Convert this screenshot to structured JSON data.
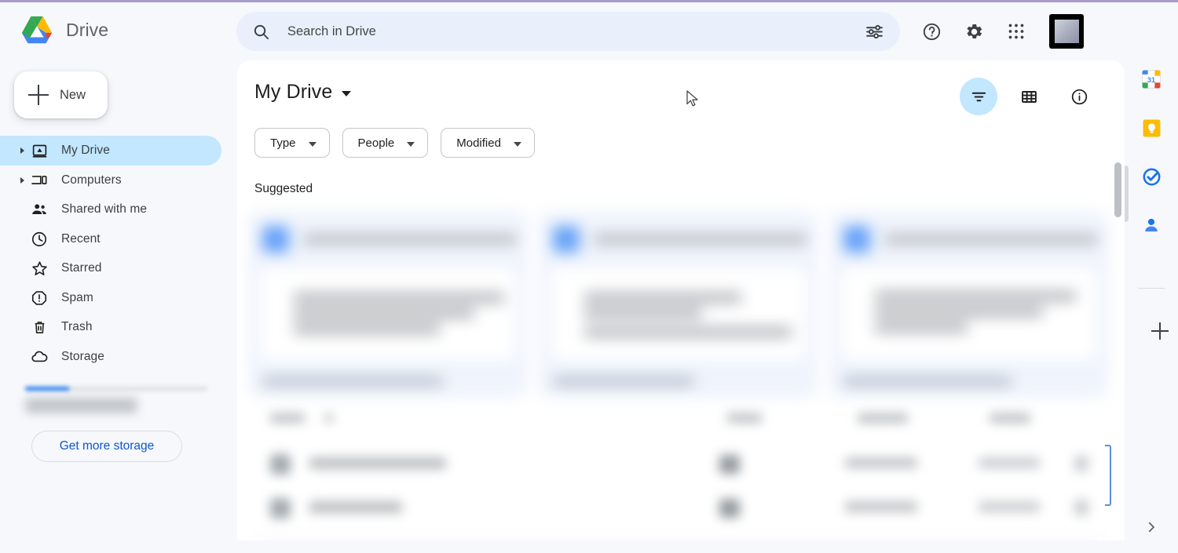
{
  "app": {
    "brand_name": "Drive",
    "logo": "drive-logo"
  },
  "search": {
    "placeholder": "Search in Drive",
    "value": "",
    "icon": "search-icon",
    "tune_icon": "tune-icon"
  },
  "topbar_icons": [
    {
      "name": "help-icon",
      "label": "Support"
    },
    {
      "name": "gear-icon",
      "label": "Settings"
    },
    {
      "name": "apps-grid-icon",
      "label": "Google apps"
    }
  ],
  "account": {
    "name": "avatar",
    "label": "Google Account"
  },
  "sidebar": {
    "new_button": {
      "label": "New",
      "icon": "plus-icon"
    },
    "items": [
      {
        "label": "My Drive",
        "icon": "my-drive-icon",
        "active": true,
        "expandable": true
      },
      {
        "label": "Computers",
        "icon": "computers-icon",
        "active": false,
        "expandable": true
      },
      {
        "label": "Shared with me",
        "icon": "shared-with-me-icon",
        "active": false,
        "expandable": false
      },
      {
        "label": "Recent",
        "icon": "clock-icon",
        "active": false,
        "expandable": false
      },
      {
        "label": "Starred",
        "icon": "star-icon",
        "active": false,
        "expandable": false
      },
      {
        "label": "Spam",
        "icon": "spam-icon",
        "active": false,
        "expandable": false
      },
      {
        "label": "Trash",
        "icon": "trash-icon",
        "active": false,
        "expandable": false
      },
      {
        "label": "Storage",
        "icon": "cloud-icon",
        "active": false,
        "expandable": false
      }
    ],
    "storage": {
      "redacted": true,
      "get_more_label": "Get more storage"
    }
  },
  "main": {
    "title": "My Drive",
    "title_caret": "chevron-down-icon",
    "filters": [
      {
        "label": "Type",
        "caret": "chevron-down-icon"
      },
      {
        "label": "People",
        "caret": "chevron-down-icon"
      },
      {
        "label": "Modified",
        "caret": "chevron-down-icon"
      }
    ],
    "tools": [
      {
        "name": "filter-list-icon",
        "label": "Filter",
        "active": true
      },
      {
        "name": "grid-view-icon",
        "label": "Grid view",
        "active": false
      },
      {
        "name": "info-icon",
        "label": "View details",
        "active": false
      }
    ],
    "section_title": "Suggested",
    "suggested_cards": [
      {
        "redacted": true
      },
      {
        "redacted": true
      },
      {
        "redacted": true
      }
    ],
    "file_list": {
      "redacted": true,
      "rows": [
        {
          "redacted": true
        },
        {
          "redacted": true
        }
      ]
    }
  },
  "right_rail": {
    "items": [
      {
        "name": "google-calendar-icon",
        "label": "Calendar",
        "badge": "31"
      },
      {
        "name": "google-keep-icon",
        "label": "Keep"
      },
      {
        "name": "google-tasks-icon",
        "label": "Tasks"
      },
      {
        "name": "google-contacts-icon",
        "label": "Contacts"
      }
    ],
    "add": {
      "name": "add-icon",
      "label": "Get add-ons"
    },
    "expand": {
      "name": "chevron-right-icon",
      "label": "Show side panel"
    }
  },
  "colors": {
    "page_bg": "#f6f8fc",
    "panel_bg": "#ffffff",
    "search_bg": "#eaf0fb",
    "active_nav": "#c2e7ff",
    "accent_blue": "#0b57d0",
    "top_border": "#a99ccc"
  }
}
